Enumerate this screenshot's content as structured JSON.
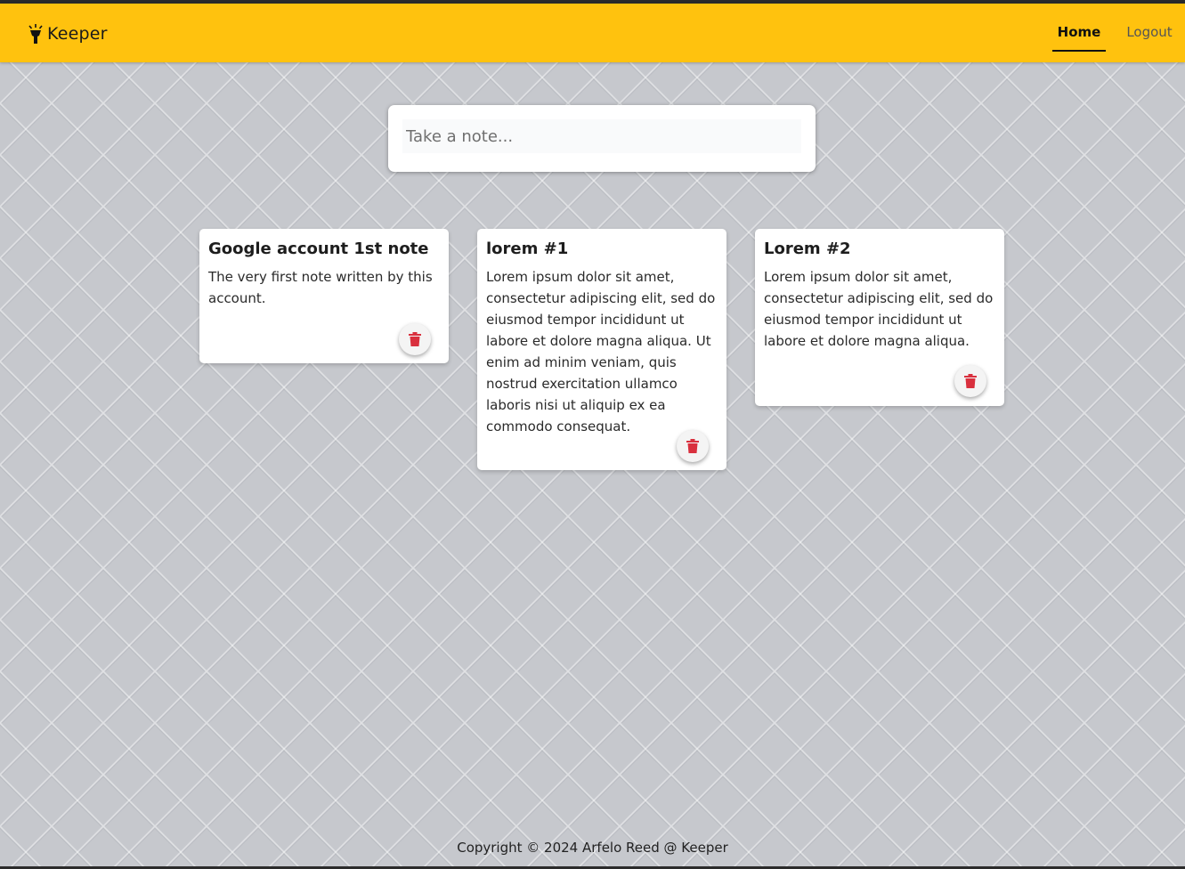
{
  "header": {
    "brand_icon": "lamp-icon",
    "brand_name": "Keeper",
    "nav": {
      "home_label": "Home",
      "logout_label": "Logout"
    }
  },
  "create_note": {
    "placeholder": "Take a note...",
    "value": ""
  },
  "notes": [
    {
      "title": "Google account 1st note",
      "content": "The very first note written by this account.",
      "delete_icon": "trash-icon"
    },
    {
      "title": "lorem #1",
      "content": "Lorem ipsum dolor sit amet, consectetur adipiscing elit, sed do eiusmod tempor incididunt ut labore et dolore magna aliqua. Ut enim ad minim veniam, quis nostrud exercitation ullamco laboris nisi ut aliquip ex ea commodo consequat.",
      "delete_icon": "trash-icon"
    },
    {
      "title": "Lorem #2",
      "content": "Lorem ipsum dolor sit amet, consectetur adipiscing elit, sed do eiusmod tempor incididunt ut labore et dolore magna aliqua.",
      "delete_icon": "trash-icon"
    }
  ],
  "footer": {
    "copyright": "Copyright © 2024 Arfelo Reed @ Keeper"
  },
  "colors": {
    "header_bg": "#ffc20e",
    "delete_icon": "#d9303e",
    "page_bg": "#c6c8cd"
  }
}
